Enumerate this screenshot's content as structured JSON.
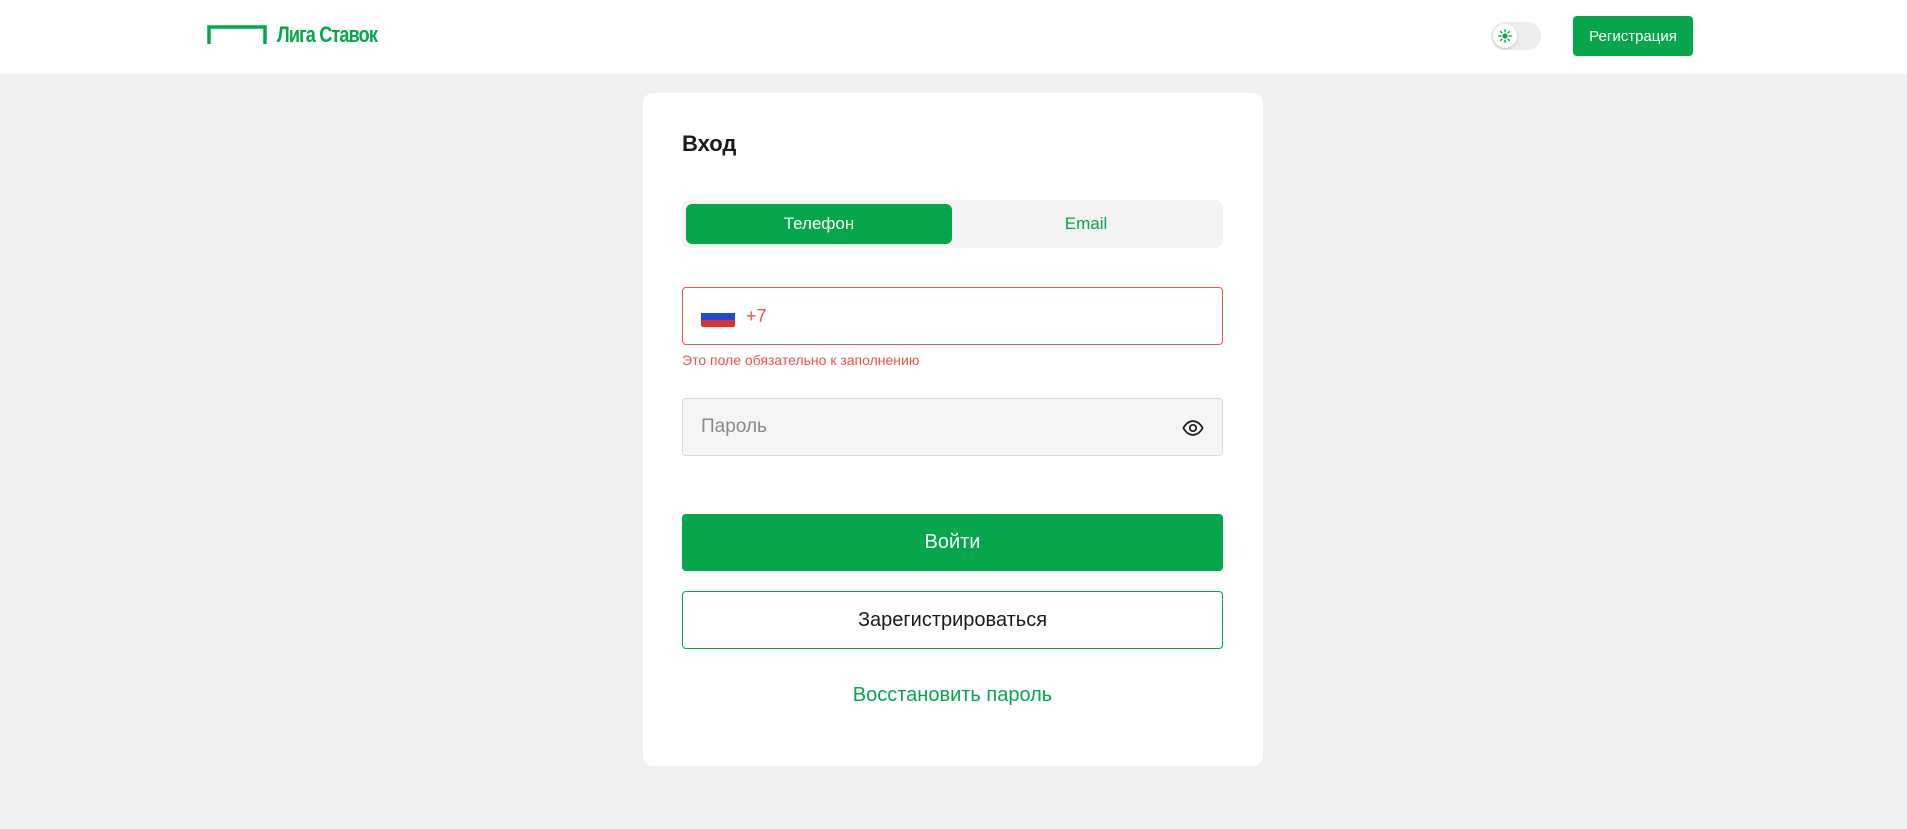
{
  "header": {
    "logo_text": "Лига Ставок",
    "register_label": "Регистрация"
  },
  "login": {
    "title": "Вход",
    "tabs": [
      {
        "label": "Телефон",
        "active": true
      },
      {
        "label": "Email",
        "active": false
      }
    ],
    "phone": {
      "prefix": "+7",
      "error": "Это поле обязательно к заполнению"
    },
    "password": {
      "placeholder": "Пароль"
    },
    "login_label": "Войти",
    "register_label": "Зарегистрироваться",
    "restore_label": "Восстановить пароль"
  },
  "colors": {
    "brand": "#06a74a",
    "error": "#f0524b",
    "background": "#f0f0f0"
  },
  "icons": [
    "logo-mark-icon",
    "sun-icon",
    "russia-flag-icon",
    "eye-icon"
  ]
}
